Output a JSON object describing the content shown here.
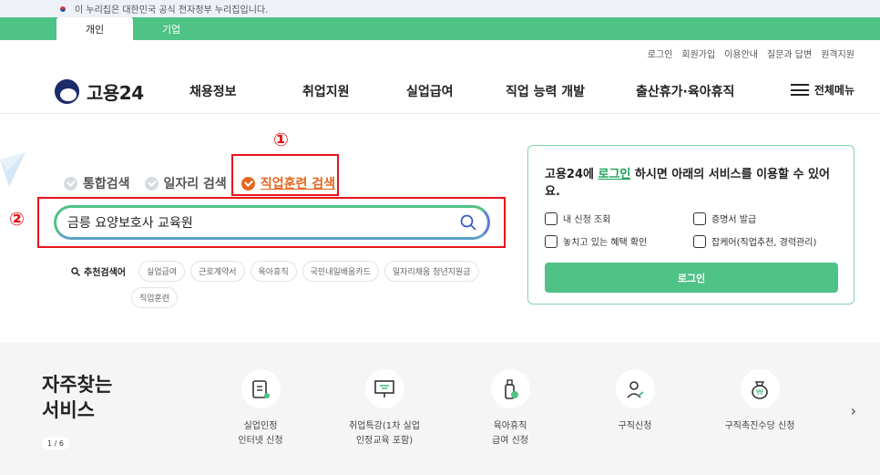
{
  "gov_bar": {
    "text": "이 누리집은 대한민국 공식 전자정부 누리집입니다."
  },
  "tabs": [
    {
      "label": "개인",
      "active": true
    },
    {
      "label": "기업",
      "active": false
    }
  ],
  "util_links": [
    "로그인",
    "회원가입",
    "이용안내",
    "질문과 답변",
    "원격지원"
  ],
  "logo": {
    "text": "고용24"
  },
  "nav": [
    "채용정보",
    "취업지원",
    "실업급여",
    "직업 능력 개발",
    "출산휴가·육아휴직"
  ],
  "all_menu": "전체메뉴",
  "annotations": {
    "marker1": "①",
    "marker2": "②"
  },
  "search": {
    "tabs": [
      {
        "label": "통합검색",
        "active": false
      },
      {
        "label": "일자리 검색",
        "active": false
      },
      {
        "label": "직업훈련 검색",
        "active": true
      }
    ],
    "query": "금릉 요양보호사 교육원",
    "recommend_label": "추천검색어",
    "recommend": [
      "실업급여",
      "근로계약서",
      "육아휴직",
      "국민내일배움카드",
      "일자리채움 청년지원금",
      "직업훈련"
    ]
  },
  "login_card": {
    "title_pre": "고용24에 ",
    "title_link": "로그인",
    "title_post": " 하시면 아래의 서비스를 이용할 수 있어요.",
    "services": [
      "내 신청 조회",
      "증명서 발급",
      "놓치고 있는 혜택 확인",
      "잡케어(직업추천, 경력관리)"
    ],
    "button": "로그인"
  },
  "faq": {
    "title_line1": "자주찾는",
    "title_line2": "서비스",
    "pager": "1 / 6",
    "items": [
      {
        "label": "실업인정\n인터넷 신청",
        "icon": "document-edit-icon"
      },
      {
        "label": "취업특강(1차 실업\n인정교육 포함)",
        "icon": "presentation-icon"
      },
      {
        "label": "육아휴직\n급여 신청",
        "icon": "baby-bottle-icon"
      },
      {
        "label": "구직신청",
        "icon": "person-edit-icon"
      },
      {
        "label": "구직촉진수당 신청",
        "icon": "money-bag-icon"
      }
    ]
  },
  "colors": {
    "green": "#4fc285",
    "orange": "#e5661e",
    "red": "#e8131b"
  }
}
